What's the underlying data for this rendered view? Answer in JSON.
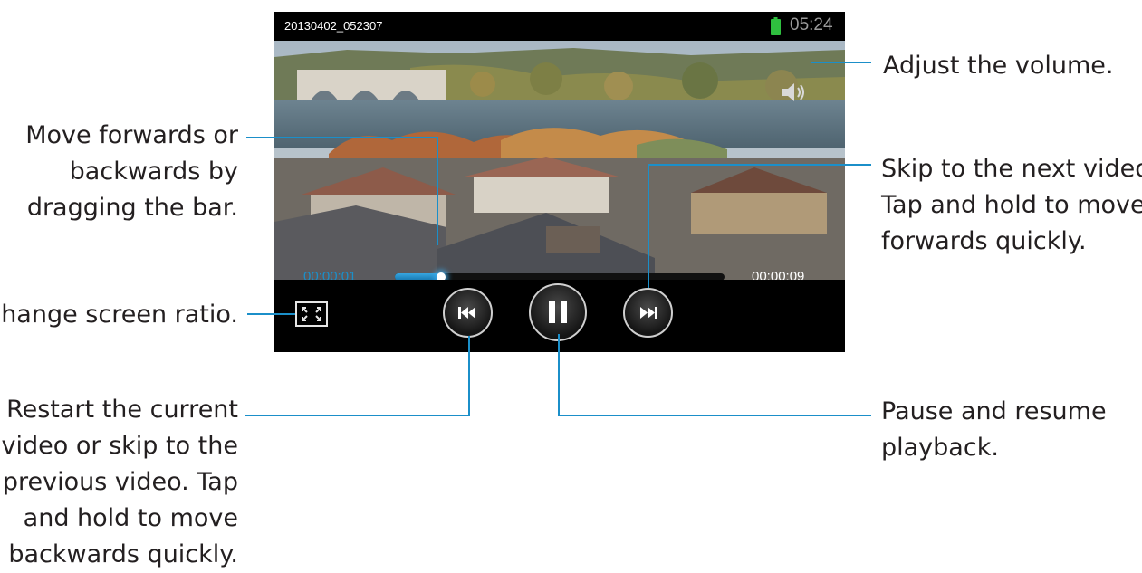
{
  "status_bar": {
    "file_name": "20130402_052307",
    "clock": "05:24",
    "battery_color": "#2fbf3f"
  },
  "player": {
    "time_current": "00:00:01",
    "time_total": "00:00:09",
    "progress": 0.14,
    "accent_color": "#1b8fc9",
    "icons": {
      "volume": "speaker-icon",
      "ratio": "screen-ratio-icon",
      "previous": "skip-previous-icon",
      "pause": "pause-icon",
      "next": "skip-next-icon"
    }
  },
  "callouts": {
    "volume": [
      "Adjust the volume."
    ],
    "seek": [
      "Move forwards or",
      "backwards by",
      "dragging the bar."
    ],
    "next": [
      "Skip to the next video.",
      "Tap and hold to move",
      "forwards quickly."
    ],
    "ratio": [
      "Change screen ratio."
    ],
    "restart": [
      "Restart the current",
      "video or skip to the",
      "previous video. Tap",
      "and hold to move",
      "backwards quickly."
    ],
    "pause": [
      "Pause and resume",
      "playback."
    ]
  }
}
